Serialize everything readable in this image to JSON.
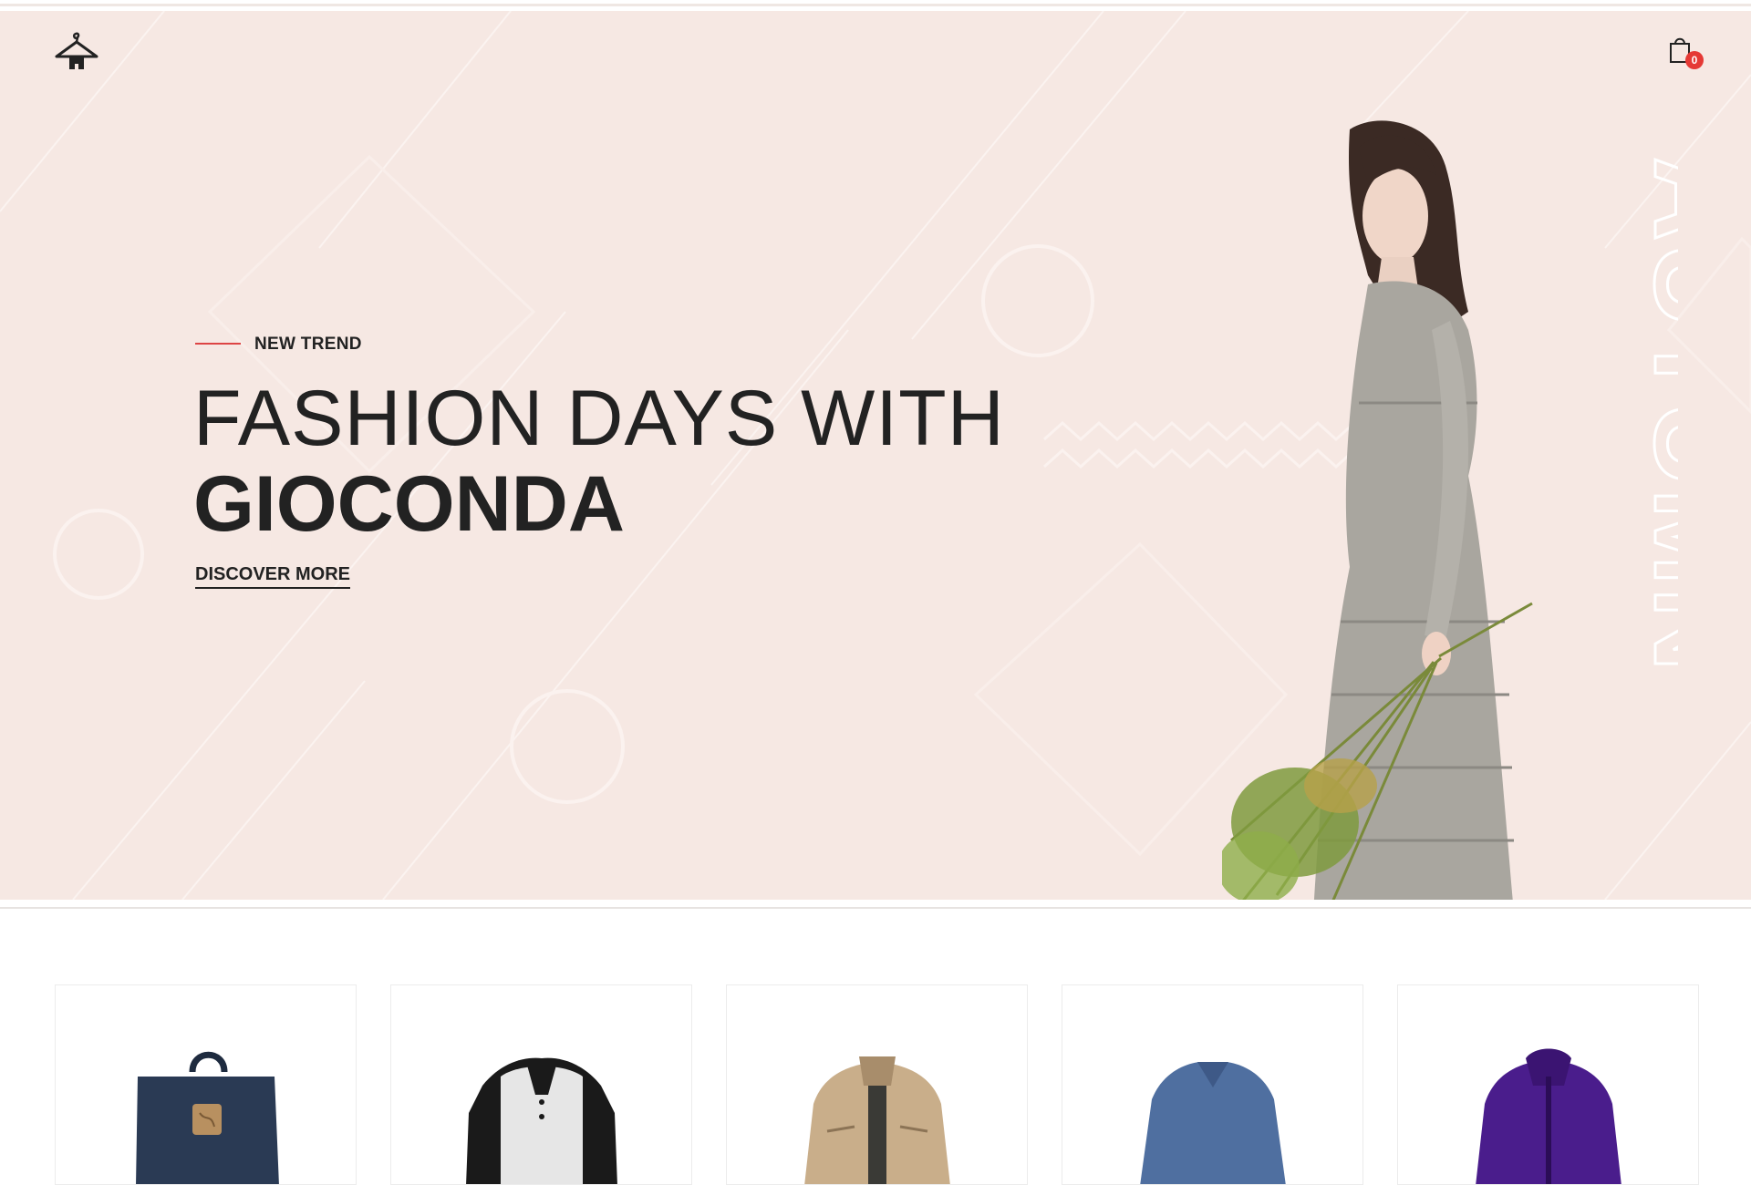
{
  "header": {
    "logo_icon": "hanger-icon",
    "cart_icon": "shopping-bag-icon",
    "cart_count": "0"
  },
  "hero": {
    "kicker": "NEW TREND",
    "title_line1": "FASHION DAYS WITH",
    "title_line2": "GIOCONDA",
    "cta_label": "DISCOVER MORE",
    "side_text": "AUTUMN",
    "background_color": "#f6e8e3",
    "accent_color": "#dd4444"
  },
  "products": [
    {
      "name": "backpack-product"
    },
    {
      "name": "raglan-henley-product"
    },
    {
      "name": "khaki-jacket-product"
    },
    {
      "name": "blue-sweater-product"
    },
    {
      "name": "purple-jacket-product"
    }
  ]
}
